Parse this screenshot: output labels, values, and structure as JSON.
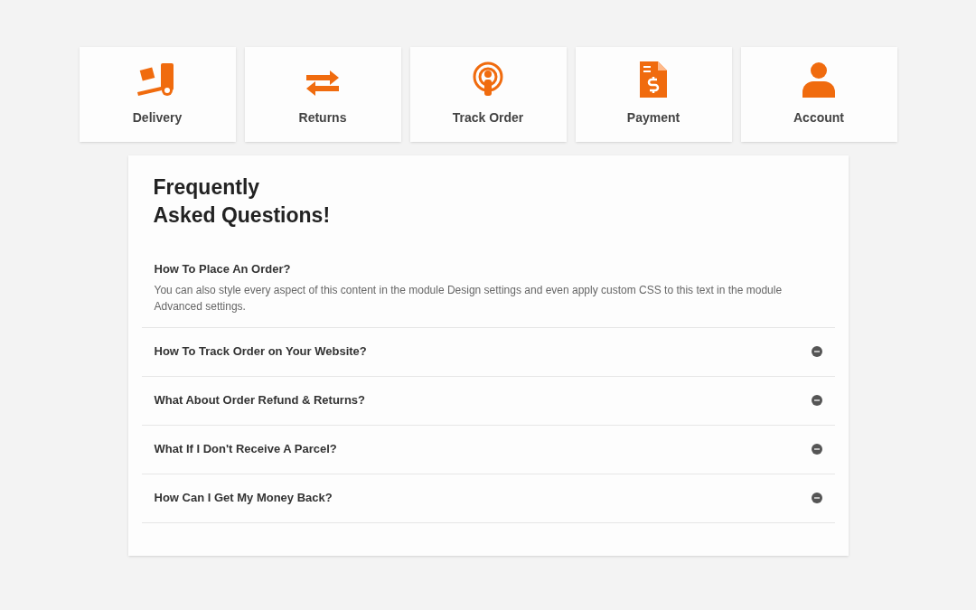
{
  "categories": [
    {
      "kind": "delivery",
      "label": "Delivery"
    },
    {
      "kind": "returns",
      "label": "Returns"
    },
    {
      "kind": "track",
      "label": "Track Order"
    },
    {
      "kind": "payment",
      "label": "Payment"
    },
    {
      "kind": "account",
      "label": "Account"
    }
  ],
  "faq": {
    "title_lines": [
      "Frequently",
      "Asked Questions!"
    ],
    "items": [
      {
        "question": "How To Place An Order?",
        "expanded": true,
        "answer": "You can also style every aspect of this content in the module Design settings and even apply custom CSS to this text in the module Advanced settings."
      },
      {
        "question": "How To Track Order on Your Website?",
        "expanded": false
      },
      {
        "question": "What About Order Refund & Returns?",
        "expanded": false
      },
      {
        "question": "What If I Don't Receive A Parcel?",
        "expanded": false
      },
      {
        "question": "How Can I Get My Money Back?",
        "expanded": false
      }
    ]
  }
}
